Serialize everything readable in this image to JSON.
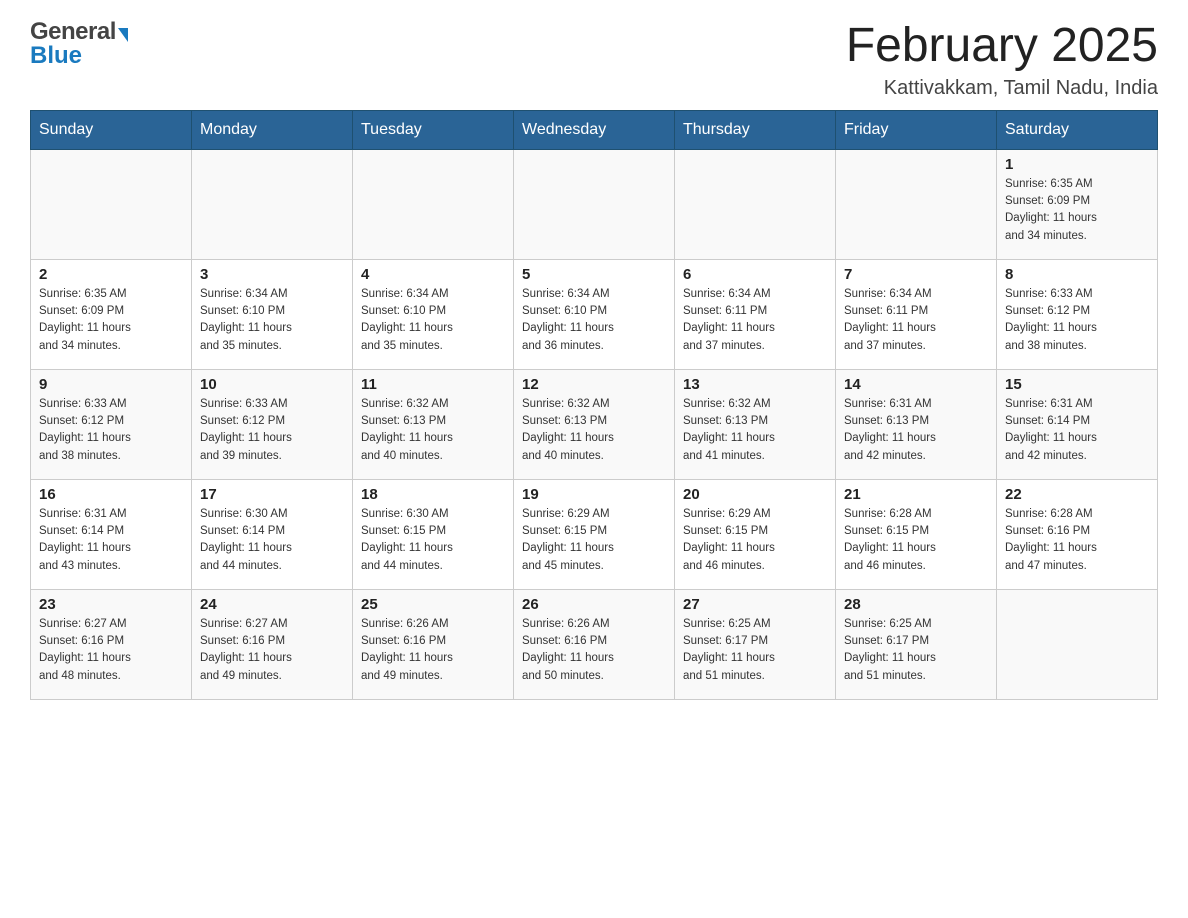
{
  "header": {
    "logo_general": "General",
    "logo_blue": "Blue",
    "title": "February 2025",
    "subtitle": "Kattivakkam, Tamil Nadu, India"
  },
  "days_of_week": [
    "Sunday",
    "Monday",
    "Tuesday",
    "Wednesday",
    "Thursday",
    "Friday",
    "Saturday"
  ],
  "weeks": [
    {
      "days": [
        {
          "num": "",
          "info": ""
        },
        {
          "num": "",
          "info": ""
        },
        {
          "num": "",
          "info": ""
        },
        {
          "num": "",
          "info": ""
        },
        {
          "num": "",
          "info": ""
        },
        {
          "num": "",
          "info": ""
        },
        {
          "num": "1",
          "info": "Sunrise: 6:35 AM\nSunset: 6:09 PM\nDaylight: 11 hours\nand 34 minutes."
        }
      ]
    },
    {
      "days": [
        {
          "num": "2",
          "info": "Sunrise: 6:35 AM\nSunset: 6:09 PM\nDaylight: 11 hours\nand 34 minutes."
        },
        {
          "num": "3",
          "info": "Sunrise: 6:34 AM\nSunset: 6:10 PM\nDaylight: 11 hours\nand 35 minutes."
        },
        {
          "num": "4",
          "info": "Sunrise: 6:34 AM\nSunset: 6:10 PM\nDaylight: 11 hours\nand 35 minutes."
        },
        {
          "num": "5",
          "info": "Sunrise: 6:34 AM\nSunset: 6:10 PM\nDaylight: 11 hours\nand 36 minutes."
        },
        {
          "num": "6",
          "info": "Sunrise: 6:34 AM\nSunset: 6:11 PM\nDaylight: 11 hours\nand 37 minutes."
        },
        {
          "num": "7",
          "info": "Sunrise: 6:34 AM\nSunset: 6:11 PM\nDaylight: 11 hours\nand 37 minutes."
        },
        {
          "num": "8",
          "info": "Sunrise: 6:33 AM\nSunset: 6:12 PM\nDaylight: 11 hours\nand 38 minutes."
        }
      ]
    },
    {
      "days": [
        {
          "num": "9",
          "info": "Sunrise: 6:33 AM\nSunset: 6:12 PM\nDaylight: 11 hours\nand 38 minutes."
        },
        {
          "num": "10",
          "info": "Sunrise: 6:33 AM\nSunset: 6:12 PM\nDaylight: 11 hours\nand 39 minutes."
        },
        {
          "num": "11",
          "info": "Sunrise: 6:32 AM\nSunset: 6:13 PM\nDaylight: 11 hours\nand 40 minutes."
        },
        {
          "num": "12",
          "info": "Sunrise: 6:32 AM\nSunset: 6:13 PM\nDaylight: 11 hours\nand 40 minutes."
        },
        {
          "num": "13",
          "info": "Sunrise: 6:32 AM\nSunset: 6:13 PM\nDaylight: 11 hours\nand 41 minutes."
        },
        {
          "num": "14",
          "info": "Sunrise: 6:31 AM\nSunset: 6:13 PM\nDaylight: 11 hours\nand 42 minutes."
        },
        {
          "num": "15",
          "info": "Sunrise: 6:31 AM\nSunset: 6:14 PM\nDaylight: 11 hours\nand 42 minutes."
        }
      ]
    },
    {
      "days": [
        {
          "num": "16",
          "info": "Sunrise: 6:31 AM\nSunset: 6:14 PM\nDaylight: 11 hours\nand 43 minutes."
        },
        {
          "num": "17",
          "info": "Sunrise: 6:30 AM\nSunset: 6:14 PM\nDaylight: 11 hours\nand 44 minutes."
        },
        {
          "num": "18",
          "info": "Sunrise: 6:30 AM\nSunset: 6:15 PM\nDaylight: 11 hours\nand 44 minutes."
        },
        {
          "num": "19",
          "info": "Sunrise: 6:29 AM\nSunset: 6:15 PM\nDaylight: 11 hours\nand 45 minutes."
        },
        {
          "num": "20",
          "info": "Sunrise: 6:29 AM\nSunset: 6:15 PM\nDaylight: 11 hours\nand 46 minutes."
        },
        {
          "num": "21",
          "info": "Sunrise: 6:28 AM\nSunset: 6:15 PM\nDaylight: 11 hours\nand 46 minutes."
        },
        {
          "num": "22",
          "info": "Sunrise: 6:28 AM\nSunset: 6:16 PM\nDaylight: 11 hours\nand 47 minutes."
        }
      ]
    },
    {
      "days": [
        {
          "num": "23",
          "info": "Sunrise: 6:27 AM\nSunset: 6:16 PM\nDaylight: 11 hours\nand 48 minutes."
        },
        {
          "num": "24",
          "info": "Sunrise: 6:27 AM\nSunset: 6:16 PM\nDaylight: 11 hours\nand 49 minutes."
        },
        {
          "num": "25",
          "info": "Sunrise: 6:26 AM\nSunset: 6:16 PM\nDaylight: 11 hours\nand 49 minutes."
        },
        {
          "num": "26",
          "info": "Sunrise: 6:26 AM\nSunset: 6:16 PM\nDaylight: 11 hours\nand 50 minutes."
        },
        {
          "num": "27",
          "info": "Sunrise: 6:25 AM\nSunset: 6:17 PM\nDaylight: 11 hours\nand 51 minutes."
        },
        {
          "num": "28",
          "info": "Sunrise: 6:25 AM\nSunset: 6:17 PM\nDaylight: 11 hours\nand 51 minutes."
        },
        {
          "num": "",
          "info": ""
        }
      ]
    }
  ]
}
